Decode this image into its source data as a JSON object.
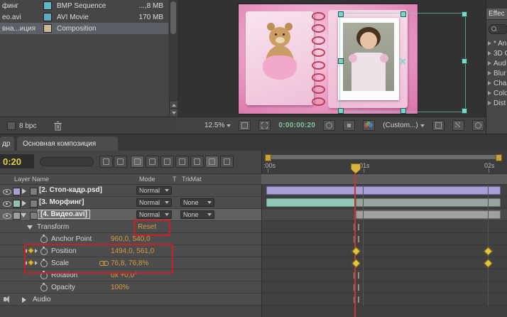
{
  "project": {
    "rows": [
      {
        "name": "финг",
        "type": "BMP Sequence",
        "size": "...,8 MB"
      },
      {
        "name": "ео.avi",
        "type": "AVI Movie",
        "size": "170 MB"
      },
      {
        "name": "вна...иция",
        "type": "Composition",
        "size": ""
      }
    ],
    "footer": {
      "bit_depth": "8 bpc"
    }
  },
  "viewer": {
    "zoom": "12.5%",
    "timecode": "0:00:00:20",
    "view_preset": "(Custom...)"
  },
  "effects_panel": {
    "tab": "Effec",
    "items": [
      {
        "label": "* An"
      },
      {
        "label": "3D C"
      },
      {
        "label": "Aud"
      },
      {
        "label": "Blur"
      },
      {
        "label": "Chan"
      },
      {
        "label": "Colo"
      },
      {
        "label": "Dist"
      }
    ]
  },
  "tabs": {
    "left_partial": "др",
    "active": "Основная композиция"
  },
  "timeline": {
    "timecode": "0:20",
    "columns": {
      "layer_name": "Layer Name",
      "mode": "Mode",
      "t": "T",
      "trkmat": "TrkMat"
    },
    "ruler": {
      "t0": ":00s",
      "t1": "01s",
      "t2": "02s"
    },
    "layers": [
      {
        "label": "[2. Стоп-кадр.psd]",
        "mode": "Normal",
        "trkmat": ""
      },
      {
        "label": "[3. Морфинг]",
        "mode": "Normal",
        "trkmat": "None"
      },
      {
        "label": "[4. Видео.avi]",
        "mode": "Normal",
        "trkmat": "None"
      }
    ],
    "properties": {
      "transform": {
        "name": "Transform",
        "reset": "Reset"
      },
      "anchor": {
        "name": "Anchor Point",
        "value": "960,0, 540,0"
      },
      "position": {
        "name": "Position",
        "value": "1494,0, 561,0"
      },
      "scale": {
        "name": "Scale",
        "value": "76,8, 76,8%"
      },
      "rotation": {
        "name": "Rotation",
        "value": "0x +0,0°"
      },
      "opacity": {
        "name": "Opacity",
        "value": "100%"
      },
      "audio": {
        "name": "Audio"
      }
    },
    "colors": {
      "value_orange": "#d79a3c",
      "timecode_yellow": "#e8cf4a",
      "cti_red": "#c8352c",
      "bar_purple": "#a89fd6",
      "bar_teal": "#8fc9b4",
      "bar_gray": "#a0a0a0",
      "keyframe_yellow": "#e3c53d",
      "annotation_red": "#c62222"
    }
  }
}
